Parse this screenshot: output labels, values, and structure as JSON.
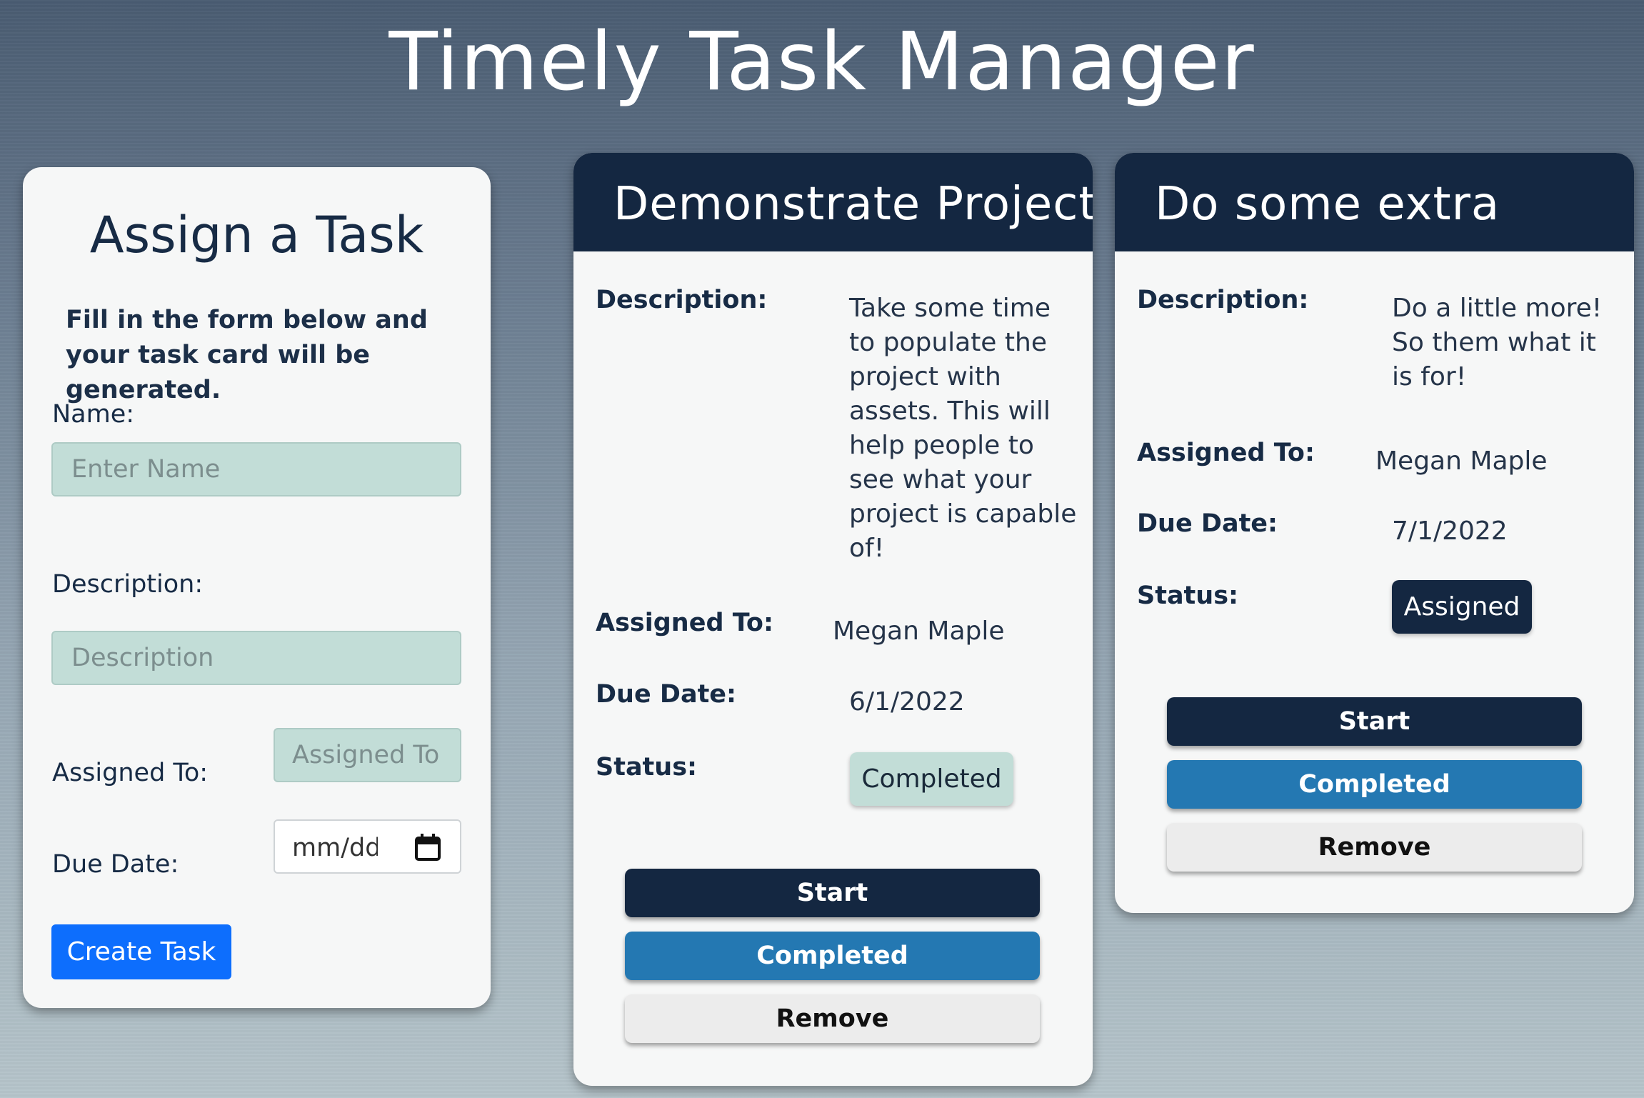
{
  "app_title": "Timely Task Manager",
  "form": {
    "title": "Assign a Task",
    "subtitle": "Fill in the form below and your task card will be generated.",
    "name_label": "Name:",
    "name_placeholder": "Enter Name",
    "description_label": "Description:",
    "description_placeholder": "Description",
    "assigned_label": "Assigned To:",
    "assigned_placeholder": "Assigned To",
    "due_label": "Due Date:",
    "due_placeholder": "mm/dd",
    "create_button": "Create Task"
  },
  "cards": [
    {
      "title": "Demonstrate Project",
      "description_label": "Description:",
      "description": "Take some time to populate the project with assets. This will help people to see what your project is capable of!",
      "assigned_label": "Assigned To:",
      "assigned": "Megan Maple",
      "due_label": "Due Date:",
      "due": "6/1/2022",
      "status_label": "Status:",
      "status": "Completed",
      "buttons": {
        "start": "Start",
        "completed": "Completed",
        "remove": "Remove"
      }
    },
    {
      "title": "Do some extra",
      "description_label": "Description:",
      "description": "Do a little more! So them what it is for!",
      "assigned_label": "Assigned To:",
      "assigned": "Megan Maple",
      "due_label": "Due Date:",
      "due": "7/1/2022",
      "status_label": "Status:",
      "status": "Assigned",
      "buttons": {
        "start": "Start",
        "completed": "Completed",
        "remove": "Remove"
      }
    }
  ],
  "colors": {
    "header_navy": "#142741",
    "completed_blue": "#2478b2",
    "input_mint": "#c2ddd7",
    "create_blue": "#0d6efd"
  },
  "icons": {
    "date_picker": "calendar-icon"
  }
}
